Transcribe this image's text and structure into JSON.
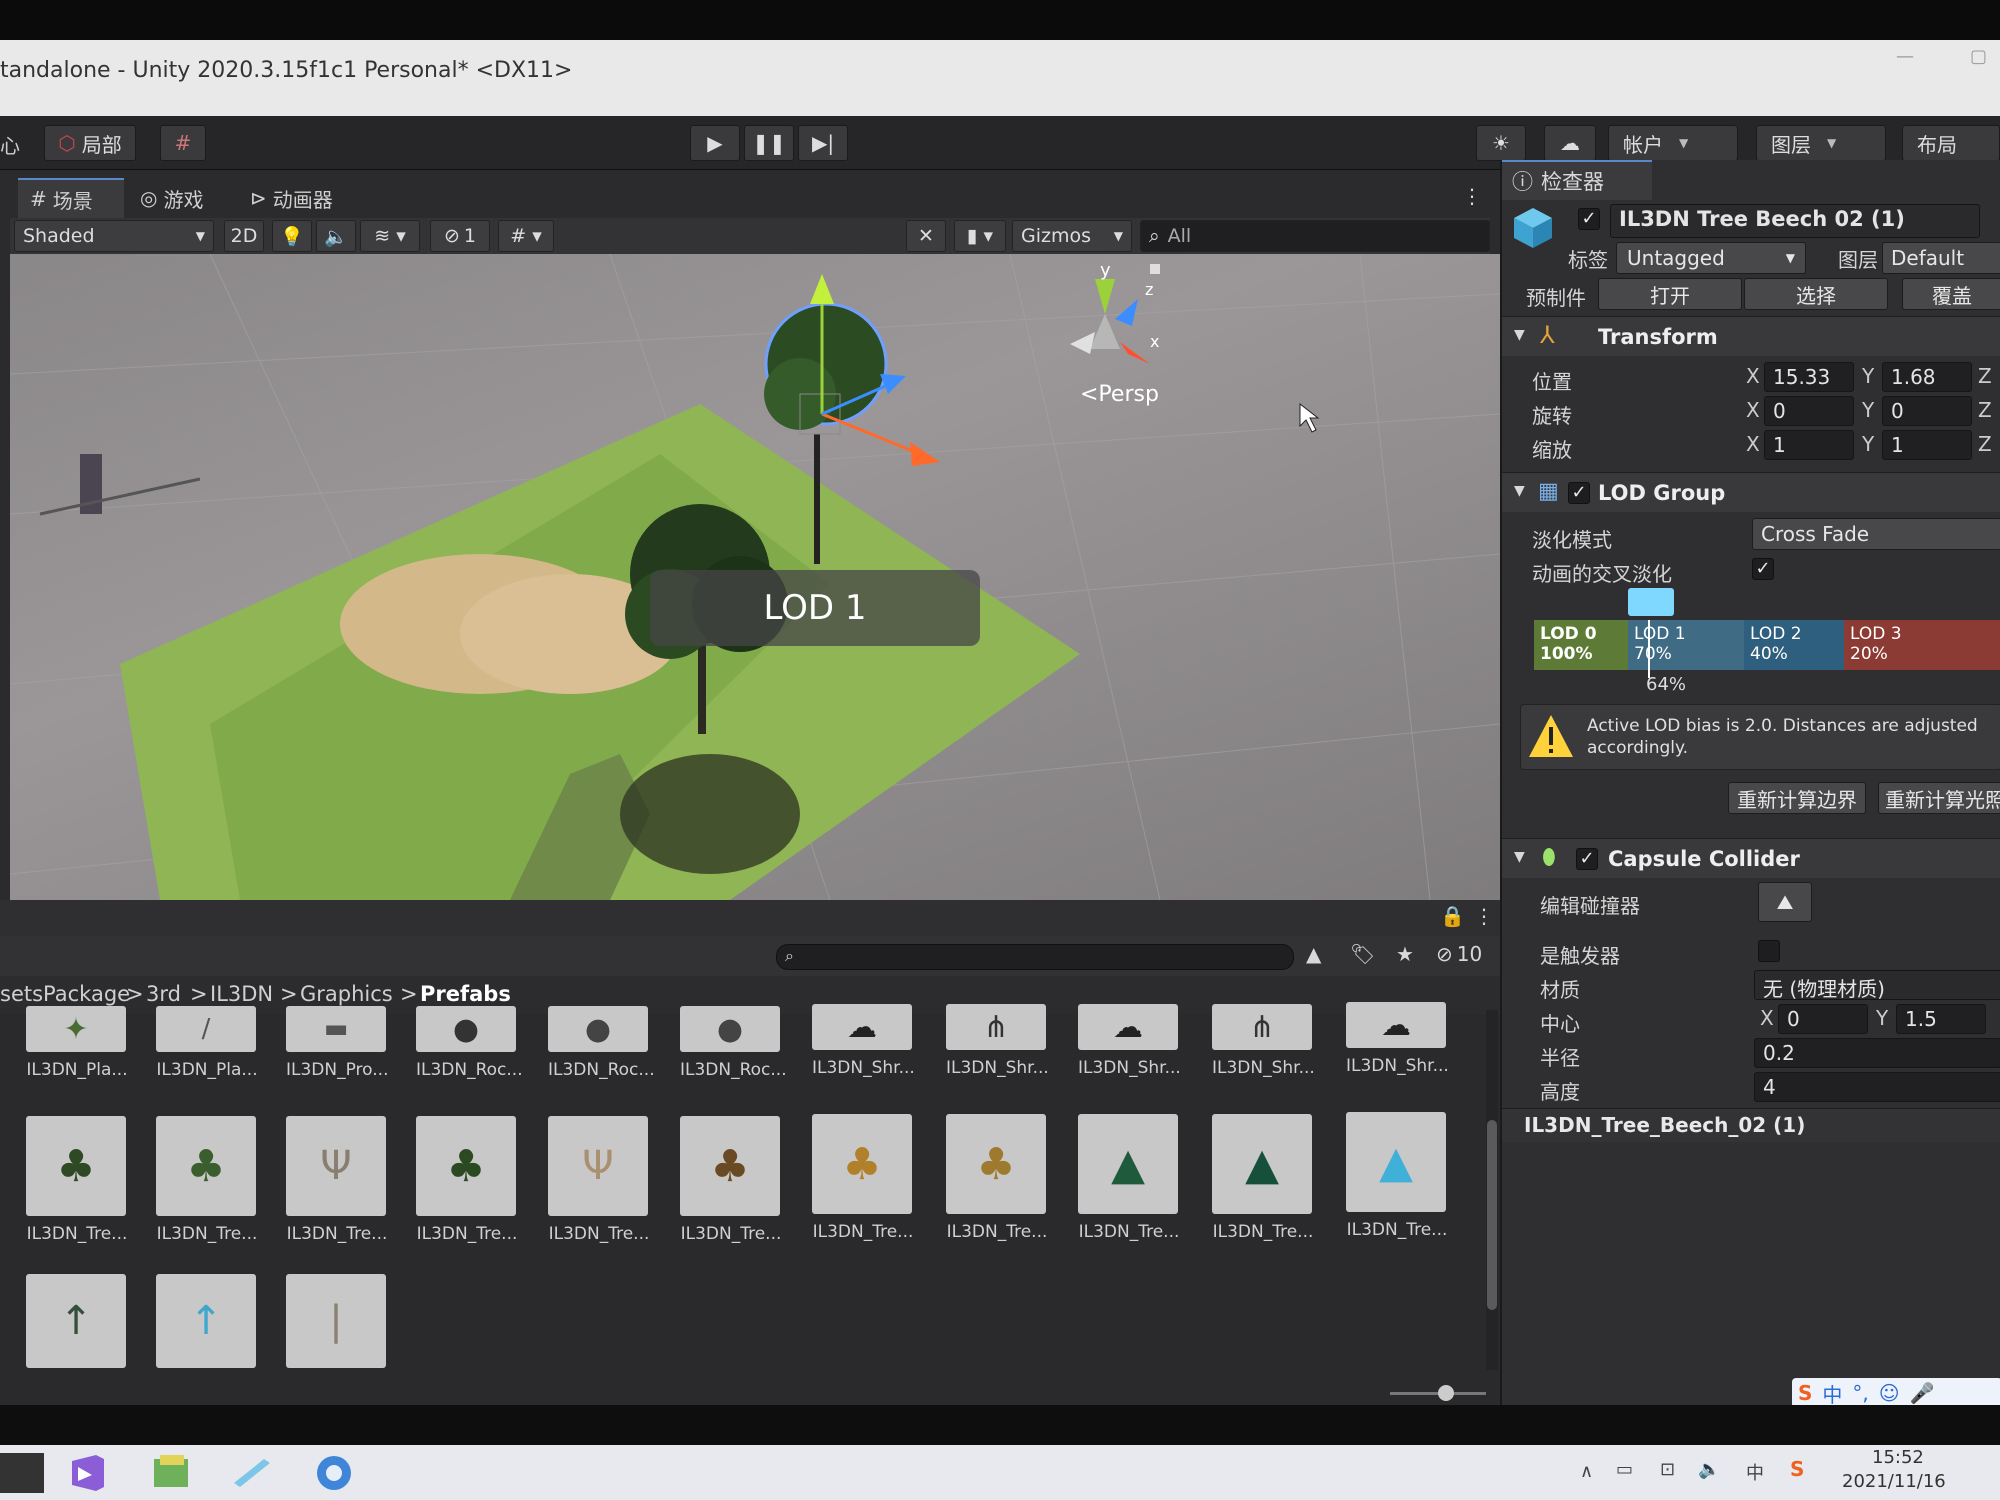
{
  "window": {
    "title": "tandalone - Unity 2020.3.15f1c1 Personal* <DX11>"
  },
  "toolbar": {
    "left_partial": "心",
    "local_label": "局部",
    "account_label": "帐户",
    "layers_label": "图层",
    "layout_label": "布局"
  },
  "scene": {
    "tabs": [
      {
        "label": "场景",
        "icon": "grid-icon"
      },
      {
        "label": "游戏",
        "icon": "gamepad-icon"
      },
      {
        "label": "动画器",
        "icon": "animator-icon"
      }
    ],
    "shading_mode": "Shaded",
    "mode_2d": "2D",
    "hidden_count": "1",
    "gizmos_label": "Gizmos",
    "search_placeholder": "All",
    "persp_label": "<Persp",
    "axis_y": "y",
    "axis_z": "z",
    "axis_x": "x",
    "lod_overlay": "LOD 1"
  },
  "inspector": {
    "tab_label": "检查器",
    "object_name": "IL3DN Tree Beech 02 (1)",
    "tag_label": "标签",
    "tag_value": "Untagged",
    "layer_label": "图层",
    "layer_value": "Default",
    "prefab_label": "预制件",
    "prefab_open": "打开",
    "prefab_select": "选择",
    "prefab_override": "覆盖",
    "transform": {
      "title": "Transform",
      "position_label": "位置",
      "rotation_label": "旋转",
      "scale_label": "缩放",
      "position": {
        "x": "15.33",
        "y": "1.68"
      },
      "rotation": {
        "x": "0",
        "y": "0"
      },
      "scale": {
        "x": "1",
        "y": "1"
      },
      "x_label": "X",
      "y_label": "Y",
      "z_label": "Z"
    },
    "lod_group": {
      "title": "LOD Group",
      "fade_mode_label": "淡化模式",
      "fade_mode_value": "Cross Fade",
      "animate_crossfade_label": "动画的交叉淡化",
      "animate_crossfade_checked": true,
      "levels": [
        {
          "name": "LOD 0",
          "percent": "100%",
          "color": "#5d7a36"
        },
        {
          "name": "LOD 1",
          "percent": "70%",
          "color": "#3f6b85"
        },
        {
          "name": "LOD 2",
          "percent": "40%",
          "color": "#2f5f7e"
        },
        {
          "name": "LOD 3",
          "percent": "20%",
          "color": "#8c3a34"
        }
      ],
      "current_marker": "64%",
      "warning": "Active LOD bias is 2.0. Distances are adjusted accordingly.",
      "recalc_bounds": "重新计算边界",
      "recalc_lightmap": "重新计算光照"
    },
    "capsule_collider": {
      "title": "Capsule Collider",
      "edit_collider_label": "编辑碰撞器",
      "is_trigger_label": "是触发器",
      "material_label": "材质",
      "material_value": "无 (物理材质)",
      "center_label": "中心",
      "center": {
        "x": "0",
        "y": "1.5"
      },
      "radius_label": "半径",
      "radius_value": "0.2",
      "height_label": "高度",
      "height_value": "4"
    },
    "footer_name": "IL3DN_Tree_Beech_02 (1)"
  },
  "project": {
    "hidden_packages": "10",
    "breadcrumb": [
      "setsPackage",
      "3rd",
      "IL3DN",
      "Graphics",
      "Prefabs"
    ],
    "row1": [
      "IL3DN_Pla...",
      "IL3DN_Pla...",
      "IL3DN_Pro...",
      "IL3DN_Roc...",
      "IL3DN_Roc...",
      "IL3DN_Roc...",
      "IL3DN_Shr...",
      "IL3DN_Shr...",
      "IL3DN_Shr...",
      "IL3DN_Shr...",
      "IL3DN_Shr..."
    ],
    "row2": [
      "IL3DN_Tre...",
      "IL3DN_Tre...",
      "IL3DN_Tre...",
      "IL3DN_Tre...",
      "IL3DN_Tre...",
      "IL3DN_Tre...",
      "IL3DN_Tre...",
      "IL3DN_Tre...",
      "IL3DN_Tre...",
      "IL3DN_Tre...",
      "IL3DN_Tre..."
    ]
  },
  "taskbar": {
    "ime_label": "中",
    "time": "15:52",
    "date": "2021/11/16"
  }
}
